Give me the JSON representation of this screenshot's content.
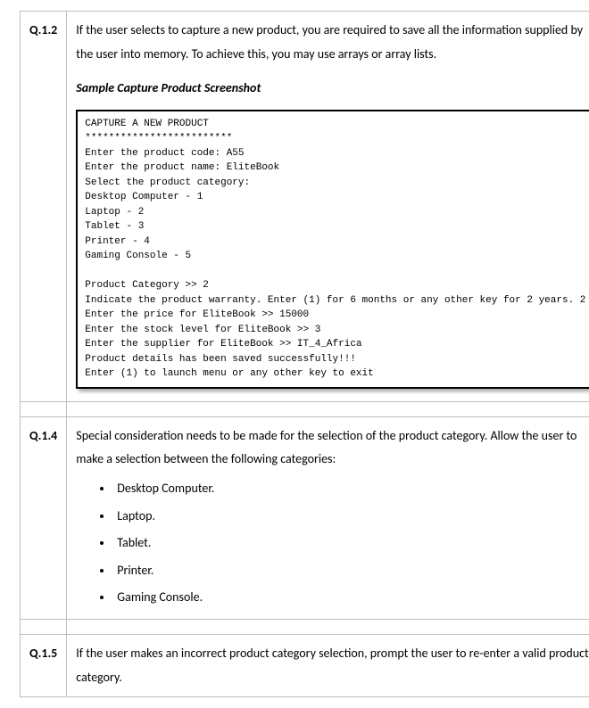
{
  "q12": {
    "number": "Q.1.2",
    "text": "If the user selects to capture a new product, you are required to save all the information supplied by the user into memory. To achieve this, you may use arrays or array lists.",
    "caption": "Sample Capture Product Screenshot",
    "console": [
      "CAPTURE A NEW PRODUCT",
      "*************************",
      "Enter the product code: A55",
      "Enter the product name: EliteBook",
      "Select the product category:",
      "Desktop Computer - 1",
      "Laptop - 2",
      "Tablet - 3",
      "Printer - 4",
      "Gaming Console - 5",
      "",
      "Product Category >> 2",
      "Indicate the product warranty. Enter (1) for 6 months or any other key for 2 years. 2",
      "Enter the price for EliteBook >> 15000",
      "Enter the stock level for EliteBook >> 3",
      "Enter the supplier for EliteBook >> IT_4_Africa",
      "Product details has been saved successfully!!!",
      "Enter (1) to launch menu or any other key to exit"
    ]
  },
  "q14": {
    "number": "Q.1.4",
    "text": "Special consideration needs to be made for the selection of the product category. Allow the user to make a selection between the following categories:",
    "items": [
      "Desktop Computer.",
      "Laptop.",
      "Tablet.",
      "Printer.",
      "Gaming Console."
    ]
  },
  "q15": {
    "number": "Q.1.5",
    "text": "If the user makes an incorrect product category selection, prompt the user to re-enter a valid product category."
  }
}
